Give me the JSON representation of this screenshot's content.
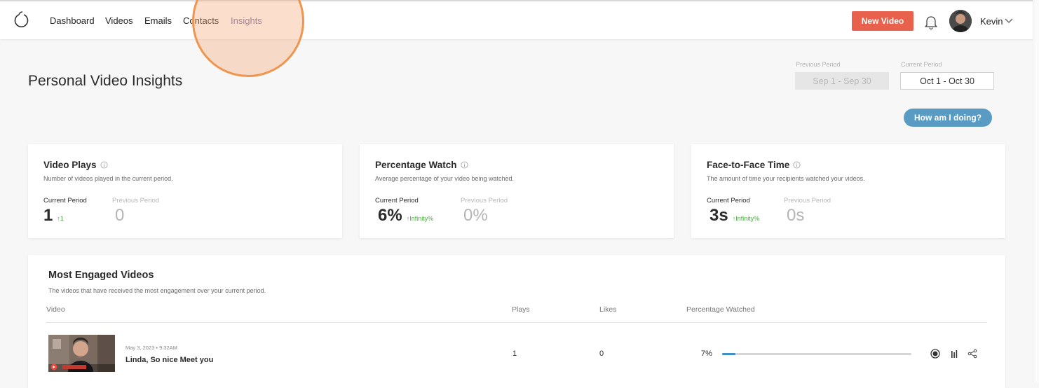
{
  "nav": {
    "items": [
      {
        "label": "Dashboard"
      },
      {
        "label": "Videos"
      },
      {
        "label": "Emails"
      },
      {
        "label": "Contacts"
      },
      {
        "label": "Insights"
      }
    ],
    "active": "Insights",
    "new_video_label": "New Video",
    "user_name": "Kevin",
    "icons": {
      "logo": "logo-icon",
      "bell": "bell-icon",
      "chevron": "chevron-down-icon"
    }
  },
  "page": {
    "title": "Personal Video Insights",
    "previous_period_label": "Previous Period",
    "previous_period_value": "Sep 1 - Sep 30",
    "current_period_label": "Current Period",
    "current_period_value": "Oct 1 - Oct 30",
    "how_label": "How am I doing?"
  },
  "cards": [
    {
      "title": "Video Plays",
      "desc": "Number of videos played in the current period.",
      "current_label": "Current Period",
      "current_value": "1",
      "delta": "↑1",
      "previous_label": "Previous Period",
      "previous_value": "0"
    },
    {
      "title": "Percentage Watch",
      "desc": "Average percentage of your video being watched.",
      "current_label": "Current Period",
      "current_value": "6%",
      "delta": "↑Infinity%",
      "previous_label": "Previous Period",
      "previous_value": "0%"
    },
    {
      "title": "Face-to-Face Time",
      "desc": "The amount of time your recipients watched your videos.",
      "current_label": "Current Period",
      "current_value": "3s",
      "delta": "↑Infinity%",
      "previous_label": "Previous Period",
      "previous_value": "0s"
    }
  ],
  "engaged": {
    "title": "Most Engaged Videos",
    "desc": "The videos that have received the most engagement over your current period.",
    "columns": {
      "video": "Video",
      "plays": "Plays",
      "likes": "Likes",
      "percentage": "Percentage Watched"
    },
    "rows": [
      {
        "date": "May 3, 2023 • 9:32AM",
        "title": "Linda, So nice Meet you",
        "plays": "1",
        "likes": "0",
        "percentage": "7%",
        "watched_fraction": 0.07
      }
    ]
  },
  "colors": {
    "accent": "#e8614c",
    "active_nav": "#7b6aa8",
    "button_blue": "#5a9bc4",
    "positive": "#4caa43",
    "progress": "#3d8fc8"
  }
}
